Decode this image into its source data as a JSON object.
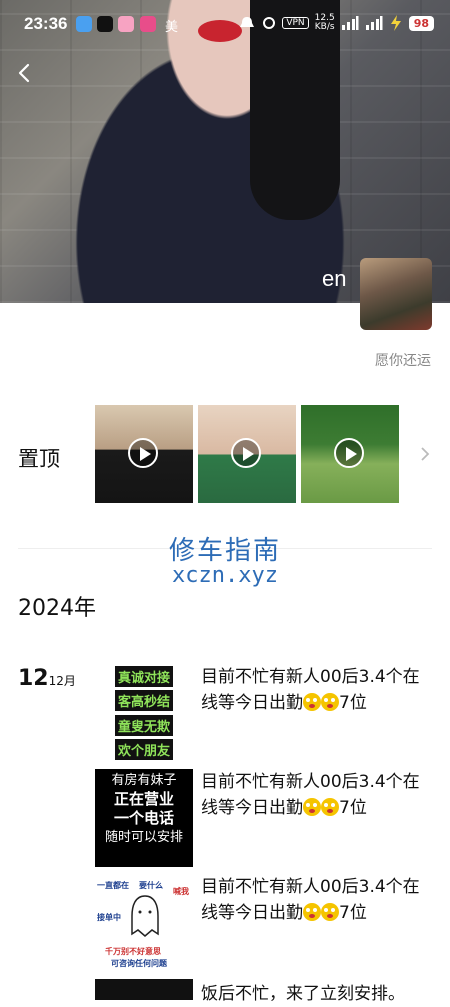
{
  "status_bar": {
    "time": "23:36",
    "carrier": "美",
    "vpn": "VPN",
    "speed_value": "12.5",
    "speed_unit": "KB/s",
    "battery": "98"
  },
  "profile": {
    "nickname": "en",
    "signature": "愿你还运"
  },
  "pinned": {
    "label": "置顶",
    "items": [
      {
        "thumb": "video",
        "colors": [
          "#d9c8b0",
          "#1a1a1a"
        ]
      },
      {
        "thumb": "video",
        "colors": [
          "#e8d4c2",
          "#2f7a48"
        ]
      },
      {
        "thumb": "video",
        "colors": [
          "#2f6f2a",
          "#86b05a"
        ]
      }
    ]
  },
  "watermark": {
    "line1": "修车指南",
    "line2": "xczn.xyz"
  },
  "timeline": {
    "year": "2024年",
    "day": "12",
    "month": "12月",
    "posts": [
      {
        "thumb_lines": [
          "真诚对接",
          "客高秒结",
          "童叟无欺",
          "欢个朋友"
        ],
        "text": "目前不忙有新人00后3.4个在线等今日出勤"
      },
      {
        "thumb_lines": [
          "有房有妹子",
          "正在营业",
          "一个电话",
          "随时可以安排"
        ],
        "text": "目前不忙有新人00后3.4个在线等今日出勤"
      },
      {
        "thumb_lines": [
          "一直都在",
          "要什么",
          "喊我",
          "接单中",
          "千万别不好意思",
          "可咨询任何问题"
        ],
        "text": "目前不忙有新人00后3.4个在线等今日出勤"
      },
      {
        "text": "饭后不忙，来了立刻安排。"
      }
    ],
    "suffix": "7位"
  },
  "colors": {
    "watermark": "#2d6cb6",
    "signature": "#888888",
    "battery": "#cc3333"
  }
}
